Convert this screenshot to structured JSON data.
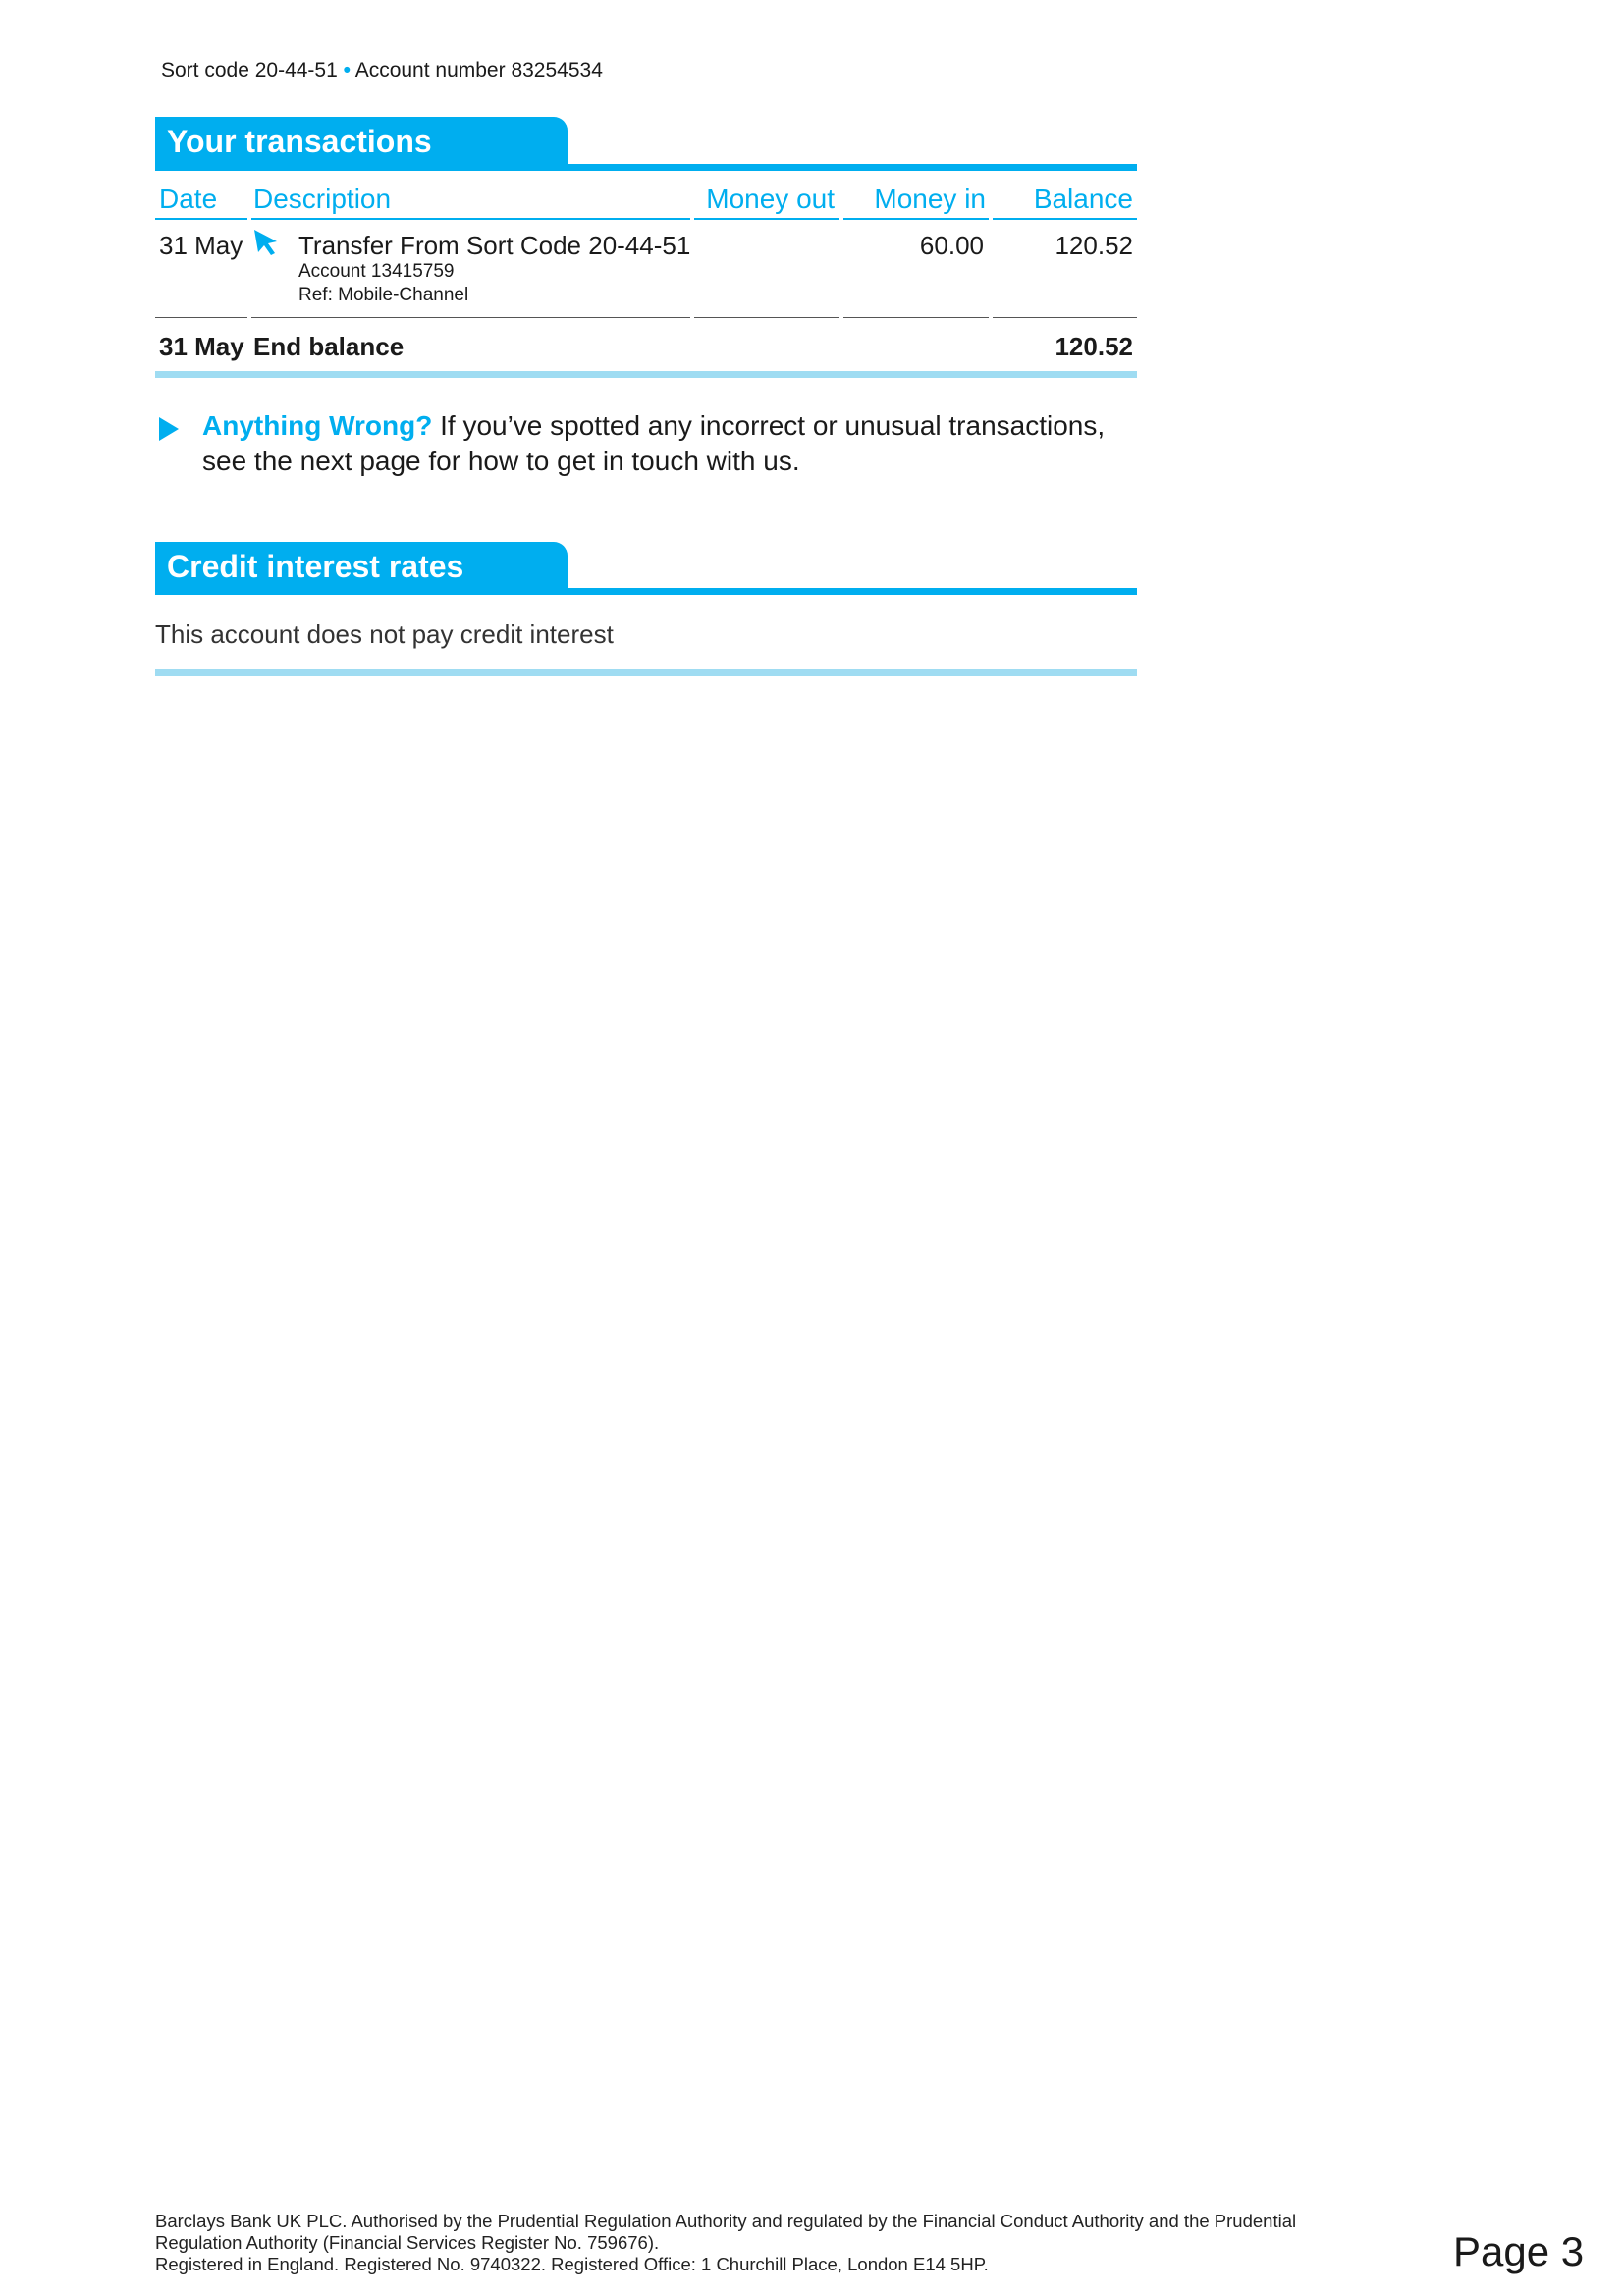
{
  "header": {
    "sort_code_label": "Sort code 20-44-51",
    "separator": "•",
    "account_number_label": "Account number 83254534"
  },
  "transactions": {
    "title": "Your transactions",
    "columns": {
      "date": "Date",
      "description": "Description",
      "money_out": "Money out",
      "money_in": "Money in",
      "balance": "Balance"
    },
    "rows": [
      {
        "date": "31 May",
        "icon": "cursor-arrow-icon",
        "description": "Transfer From Sort Code 20-44-51",
        "detail_1": "Account 13415759",
        "detail_2": "Ref: Mobile-Channel",
        "money_out": "",
        "money_in": "60.00",
        "balance": "120.52"
      }
    ],
    "end": {
      "date": "31 May",
      "label": "End balance",
      "balance": "120.52"
    }
  },
  "notice": {
    "lead": "Anything Wrong?",
    "text": " If you’ve spotted any incorrect or unusual transactions, see the next page for how to get in touch with us."
  },
  "credit": {
    "title": "Credit interest rates",
    "text": "This account does not pay credit interest"
  },
  "footer": {
    "line1": "Barclays Bank UK PLC. Authorised by the Prudential Regulation Authority and regulated by the Financial Conduct Authority and the Prudential",
    "line2": "Regulation Authority (Financial Services Register No. 759676).",
    "line3": "Registered in England. Registered No. 9740322. Registered Office: 1 Churchill Place, London E14 5HP."
  },
  "page": {
    "label": "Page 3"
  },
  "colors": {
    "accent": "#00aeef",
    "accent_light": "#9fdcf2"
  }
}
